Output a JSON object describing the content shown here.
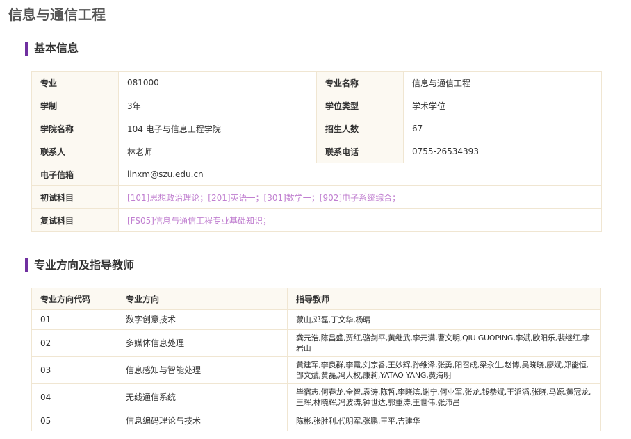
{
  "page_title": "信息与通信工程",
  "basic_info": {
    "heading": "基本信息",
    "major_code_label": "专业",
    "major_code": "081000",
    "major_name_label": "专业名称",
    "major_name": "信息与通信工程",
    "duration_label": "学制",
    "duration": "3年",
    "degree_type_label": "学位类型",
    "degree_type": "学术学位",
    "college_label": "学院名称",
    "college": "104 电子与信息工程学院",
    "enrollment_label": "招生人数",
    "enrollment": "67",
    "contact_label": "联系人",
    "contact": "林老师",
    "phone_label": "联系电话",
    "phone": "0755-26534393",
    "email_label": "电子信箱",
    "email": "linxm@szu.edu.cn",
    "initial_exam_label": "初试科目",
    "initial_exam": "[101]思想政治理论；[201]英语一；[301]数学一；[902]电子系统综合；",
    "retest_label": "复试科目",
    "retest": "[FS05]信息与通信工程专业基础知识；"
  },
  "directions": {
    "heading": "专业方向及指导教师",
    "headers": {
      "code": "专业方向代码",
      "name": "专业方向",
      "teachers": "指导教师"
    },
    "rows": [
      {
        "code": "01",
        "name": "数字创意技术",
        "teachers": "蒙山,邓磊,丁文华,杨晴"
      },
      {
        "code": "02",
        "name": "多媒体信息处理",
        "teachers": "龚元浩,陈昌盛,贾红,骆剑平,黄继武,李元满,曹文明,QIU GUOPING,李斌,欧阳乐,裴继红,李岩山"
      },
      {
        "code": "03",
        "name": "信息感知与智能处理",
        "teachers": "黄建军,李良群,李霞,刘宗香,王妙辉,孙维泽,张勇,阳召成,梁永生,赵博,吴晓晓,廖斌,郑能恒,邹文斌,黄磊,冯大权,康莉,YATAO YANG,黄海明"
      },
      {
        "code": "04",
        "name": "无线通信系统",
        "teachers": "毕宿志,何春龙,全智,袁涛,陈哲,李晓滨,谢宁,何业军,张龙,钱恭斌,王滔滔,张晓,马嫄,黄冠龙,王晖,林晓辉,冯波涛,钟世达,郭重涛,王世伟,张沛昌"
      },
      {
        "code": "05",
        "name": "信息编码理论与技术",
        "teachers": "陈彬,张胜利,代明军,张鹏,王平,吉建华"
      }
    ]
  }
}
